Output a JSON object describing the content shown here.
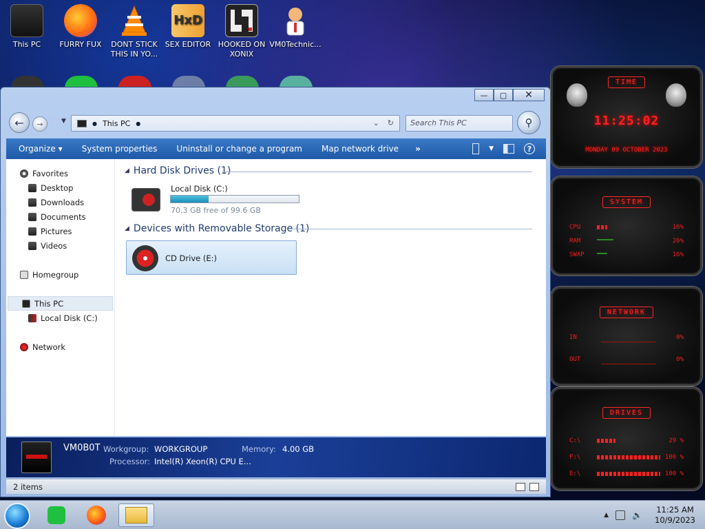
{
  "desktop": {
    "icons": [
      {
        "label": "This PC"
      },
      {
        "label": "FURRY FUX"
      },
      {
        "label": "DONT STICK THIS IN YO..."
      },
      {
        "label": "SEX EDITOR"
      },
      {
        "label": "HOOKED ON XONIX"
      },
      {
        "label": "VM0Technic..."
      }
    ],
    "hxd_logo": "HxD"
  },
  "window": {
    "controls": {
      "minimize": "—",
      "maximize": "▢",
      "close": "✕"
    },
    "address": {
      "location": "This PC"
    },
    "search": {
      "placeholder": "Search This PC"
    },
    "toolbar": {
      "organize": "Organize ▾",
      "system_properties": "System properties",
      "uninstall": "Uninstall or change a program",
      "map_drive": "Map network drive",
      "more": "»"
    },
    "nav": {
      "favorites": "Favorites",
      "desktop": "Desktop",
      "downloads": "Downloads",
      "documents": "Documents",
      "pictures": "Pictures",
      "videos": "Videos",
      "homegroup": "Homegroup",
      "this_pc": "This PC",
      "local_disk": "Local Disk (C:)",
      "network": "Network"
    },
    "groups": {
      "hard_disk": "Hard Disk Drives (1)",
      "removable": "Devices with Removable Storage (1)"
    },
    "drives": {
      "c": {
        "name": "Local Disk (C:)",
        "free": "70.3 GB free of 99.6 GB",
        "used_fraction": 0.294
      },
      "e": {
        "name": "CD Drive (E:)"
      }
    },
    "details": {
      "computer_name": "VM0B0T",
      "workgroup_label": "Workgroup:",
      "workgroup": "WORKGROUP",
      "memory_label": "Memory:",
      "memory": "4.00 GB",
      "processor_label": "Processor:",
      "processor": "Intel(R) Xeon(R) CPU E..."
    },
    "status": {
      "items": "2 items"
    }
  },
  "gadgets": {
    "time": {
      "title": "TIME",
      "clock": "11:25:02",
      "date": "MONDAY 09 OCTOBER 2023"
    },
    "system": {
      "title": "SYSTEM",
      "rows": [
        {
          "label": "CPU",
          "value": "16%",
          "level": 0.16
        },
        {
          "label": "RAM",
          "value": "26%",
          "level": 0.26
        },
        {
          "label": "SWAP",
          "value": "16%",
          "level": 0.16
        }
      ]
    },
    "network": {
      "title": "NETWORK",
      "rows": [
        {
          "label": "IN",
          "value": "0%"
        },
        {
          "label": "OUT",
          "value": "0%"
        }
      ]
    },
    "drives": {
      "title": "DRIVES",
      "rows": [
        {
          "label": "C:\\",
          "value": "29 %",
          "level": 0.29
        },
        {
          "label": "F:\\",
          "value": "100 %",
          "level": 1.0
        },
        {
          "label": "E:\\",
          "value": "100 %",
          "level": 1.0
        }
      ]
    }
  },
  "taskbar": {
    "clock_time": "11:25 AM",
    "clock_date": "10/9/2023"
  }
}
